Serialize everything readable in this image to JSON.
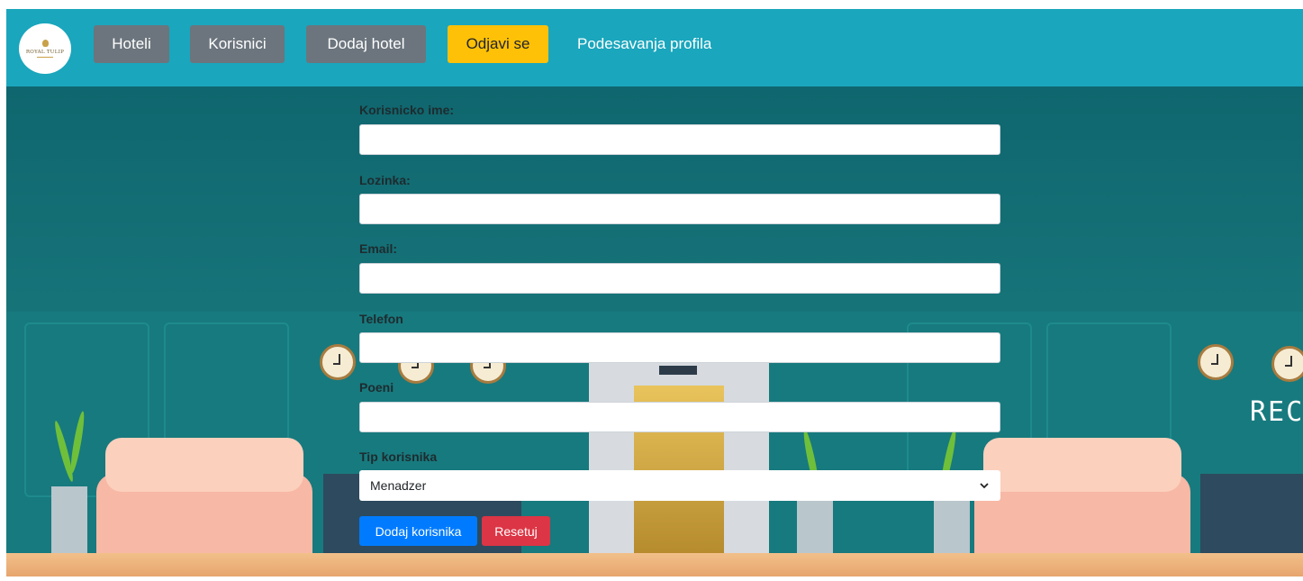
{
  "logo": {
    "text": "ROYAL TULIP"
  },
  "nav": {
    "hoteli": "Hoteli",
    "korisnici": "Korisnici",
    "dodaj_hotel": "Dodaj hotel",
    "odjavi_se": "Odjavi se",
    "podesavanja": "Podesavanja profila"
  },
  "form": {
    "username_label": "Korisnicko ime:",
    "password_label": "Lozinka:",
    "email_label": "Email:",
    "phone_label": "Telefon",
    "points_label": "Poeni",
    "type_label": "Tip korisnika",
    "type_selected": "Menadzer",
    "submit_label": "Dodaj korisnika",
    "reset_label": "Resetuj"
  },
  "scene": {
    "reception_text": "RECEP"
  },
  "colors": {
    "navbar": "#1aa6bd",
    "nav_gray": "#6c757d",
    "logout_yellow": "#ffc107",
    "primary_blue": "#007bff",
    "danger_red": "#dc3545",
    "wall_teal": "#146e74"
  }
}
